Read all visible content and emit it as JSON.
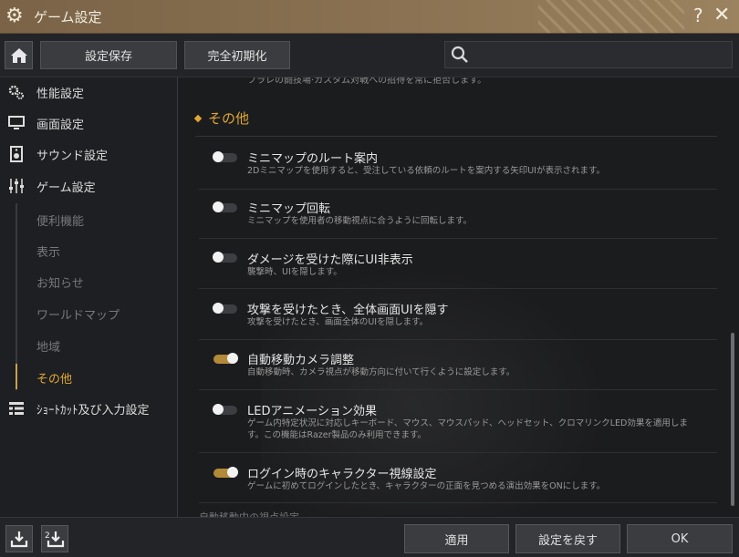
{
  "window": {
    "title": "ゲーム設定",
    "help_label": "?",
    "close_label": "✕"
  },
  "toolbar": {
    "save_label": "設定保存",
    "reset_label": "完全初期化",
    "search_placeholder": ""
  },
  "sidebar": {
    "items": [
      {
        "label": "性能設定",
        "icon": "gears-icon"
      },
      {
        "label": "画面設定",
        "icon": "monitor-icon"
      },
      {
        "label": "サウンド設定",
        "icon": "speaker-icon"
      },
      {
        "label": "ゲーム設定",
        "icon": "sliders-icon"
      }
    ],
    "sub_items": [
      {
        "label": "便利機能"
      },
      {
        "label": "表示"
      },
      {
        "label": "お知らせ"
      },
      {
        "label": "ワールドマップ"
      },
      {
        "label": "地域"
      },
      {
        "label": "その他"
      }
    ],
    "shortcut_label": "ｼｮｰﾄｶｯﾄ及び入力設定"
  },
  "content": {
    "cut_off_text": "フラレの闘技場·カスタム対戦への招待を常に拒否します。",
    "section_title": "その他",
    "options": [
      {
        "title": "ミニマップのルート案内",
        "desc": "2Dミニマップを使用すると、受注している依頼のルートを案内する矢印UIが表示されます。",
        "enabled": false
      },
      {
        "title": "ミニマップ回転",
        "desc": "ミニマップを使用者の移動視点に合うように回転します。",
        "enabled": false
      },
      {
        "title": "ダメージを受けた際にUI非表示",
        "desc": "襲撃時、UIを隠します。",
        "enabled": false
      },
      {
        "title": "攻撃を受けたとき、全体画面UIを隠す",
        "desc": "攻撃を受けたとき、画面全体のUIを隠します。",
        "enabled": false
      },
      {
        "title": "自動移動カメラ調整",
        "desc": "自動移動時、カメラ視点が移動方向に付いて行くように設定します。",
        "enabled": true
      },
      {
        "title": "LEDアニメーション効果",
        "desc": "ゲーム内特定状況に対応しキーボード、マウス、マウスパッド、ヘッドセット、クロマリンクLED効果を適用します。この機能はRazer製品のみ利用できます。",
        "enabled": false
      },
      {
        "title": "ログイン時のキャラクター視線設定",
        "desc": "ゲームに初めてログインしたとき、キャラクターの正面を見つめる演出効果をONにします。",
        "enabled": true
      }
    ],
    "cut_off_bottom": "自動移動中の視点設定"
  },
  "footer": {
    "apply_label": "適用",
    "revert_label": "設定を戻す",
    "ok_label": "OK",
    "export_label": "",
    "import_label": "2"
  },
  "colors": {
    "accent": "#e0a833",
    "titlebar": "#8a7252",
    "toggle_on": "#b38a3a"
  }
}
